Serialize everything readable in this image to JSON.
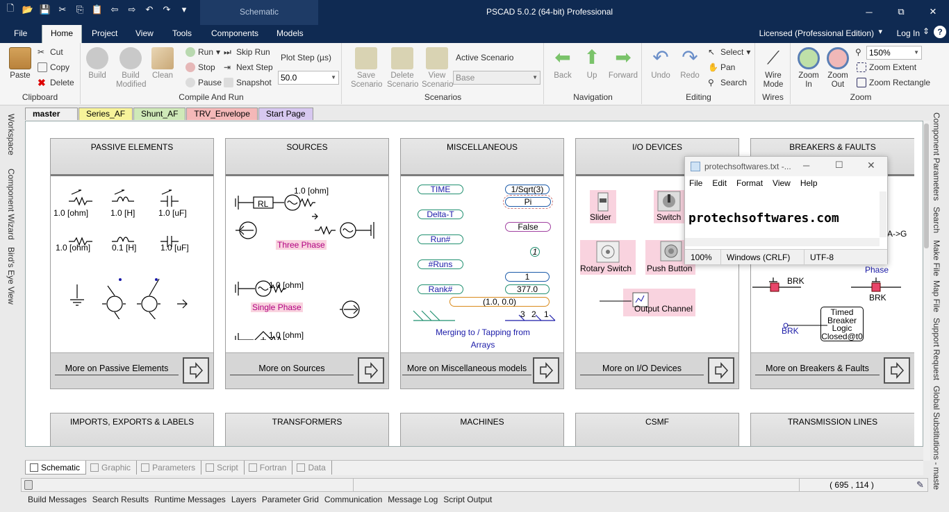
{
  "app": {
    "title": "PSCAD 5.0.2 (64-bit) Professional",
    "context_tab": "Schematic",
    "license": "Licensed (Professional Edition)",
    "login": "Log In"
  },
  "window_controls": {
    "minimize": "─",
    "maximize": "⧉",
    "close": "✕"
  },
  "ribbon_tabs": [
    "File",
    "Home",
    "Project",
    "View",
    "Tools",
    "Components",
    "Models"
  ],
  "ribbon": {
    "clipboard": {
      "label": "Clipboard",
      "paste": "Paste",
      "cut": "Cut",
      "copy": "Copy",
      "delete": "Delete"
    },
    "compile": {
      "label": "Compile And Run",
      "build": "Build",
      "build_modified_1": "Build",
      "build_modified_2": "Modified",
      "clean": "Clean",
      "run": "Run",
      "stop": "Stop",
      "pause": "Pause",
      "skip_run": "Skip Run",
      "next_step": "Next Step",
      "snapshot": "Snapshot",
      "plot_step_label": "Plot Step (µs)",
      "plot_step_value": "50.0"
    },
    "scenarios": {
      "label": "Scenarios",
      "save_1": "Save",
      "save_2": "Scenario",
      "delete_1": "Delete",
      "delete_2": "Scenario",
      "view_1": "View",
      "view_2": "Scenario",
      "active_label": "Active Scenario",
      "active_value": "Base"
    },
    "navigation": {
      "label": "Navigation",
      "back": "Back",
      "up": "Up",
      "forward": "Forward"
    },
    "editing": {
      "label": "Editing",
      "undo": "Undo",
      "redo": "Redo",
      "select": "Select",
      "pan": "Pan",
      "search": "Search"
    },
    "wires": {
      "label": "Wires",
      "wire_1": "Wire",
      "wire_2": "Mode"
    },
    "zoom": {
      "label": "Zoom",
      "zoom_in_1": "Zoom",
      "zoom_in_2": "In",
      "zoom_out_1": "Zoom",
      "zoom_out_2": "Out",
      "zoom_level": "150%",
      "zoom_extent": "Zoom Extent",
      "zoom_rectangle": "Zoom Rectangle"
    }
  },
  "left_side": [
    "Workspace",
    "Component Wizard",
    "Bird's Eye View"
  ],
  "right_side": [
    "Component Parameters",
    "Search",
    "Make File",
    "Map File",
    "Support Request",
    "Global Substitutions - maste"
  ],
  "doc_tabs": [
    {
      "label": "master",
      "close": "✕",
      "color": "#f0f0f0"
    },
    {
      "label": "Series_AF",
      "color": "#f7f39a"
    },
    {
      "label": "Shunt_AF",
      "color": "#cfe9b8"
    },
    {
      "label": "TRV_Envelope",
      "color": "#f4b8b8"
    },
    {
      "label": "Start Page",
      "color": "#d7c8f0"
    }
  ],
  "panels": {
    "passive": {
      "title": "PASSIVE ELEMENTS",
      "more": "More on Passive Elements",
      "labels": [
        "1.0 [ohm]",
        "1.0 [H]",
        "1.0 [uF]",
        "1.0 [ohm]",
        "0.1 [H]",
        "1.0 [uF]"
      ]
    },
    "sources": {
      "title": "SOURCES",
      "more": "More on Sources",
      "rl": "RL",
      "ohm1": "1.0 [ohm]",
      "three_phase": "Three Phase",
      "ohm2": "1.0 [ohm]",
      "single_phase": "Single Phase",
      "ohm3": "1.0 [ohm]"
    },
    "misc": {
      "title": "MISCELLANEOUS",
      "more": "More on Miscellaneous models",
      "time": "TIME",
      "delta_t": "Delta-T",
      "run": "Run#",
      "runs": "#Runs",
      "rank": "Rank#",
      "sqrt": "1/Sqrt(3)",
      "pi": "Pi",
      "false": "False",
      "one": "1",
      "val377": "377.0",
      "complex": "(1.0, 0.0)",
      "merge": "Merging to / Tapping from",
      "arrays": "Arrays",
      "n3": "3",
      "n2": "2",
      "n1": "1"
    },
    "io": {
      "title": "I/O DEVICES",
      "more": "More on I/O Devices",
      "slider": "Slider",
      "switch": "Switch",
      "rotary": "Rotary Switch",
      "push": "Push Button",
      "output": "Output Channel"
    },
    "breakers": {
      "title": "BREAKERS & FAULTS",
      "more": "More on Breakers & Faults",
      "ag": "A->G",
      "phase": "Phase",
      "brk1": "BRK",
      "brk2": "BRK",
      "brk3": "BRK",
      "timed": [
        "Timed",
        "Breaker",
        "Logic",
        "Closed@t0"
      ]
    },
    "row2": [
      "IMPORTS, EXPORTS & LABELS",
      "TRANSFORMERS",
      "MACHINES",
      "CSMF",
      "TRANSMISSION LINES"
    ]
  },
  "notepad": {
    "title": "protechsoftwares.txt -...",
    "menu": [
      "File",
      "Edit",
      "Format",
      "View",
      "Help"
    ],
    "text": "protechsoftwares.com",
    "status": [
      "100%",
      "Windows (CRLF)",
      "UTF-8"
    ]
  },
  "view_tabs": [
    "Schematic",
    "Graphic",
    "Parameters",
    "Script",
    "Fortran",
    "Data"
  ],
  "status": {
    "coords": "( 695 , 114 )"
  },
  "output_tabs": [
    "Build Messages",
    "Search Results",
    "Runtime Messages",
    "Layers",
    "Parameter Grid",
    "Communication",
    "Message Log",
    "Script Output"
  ]
}
